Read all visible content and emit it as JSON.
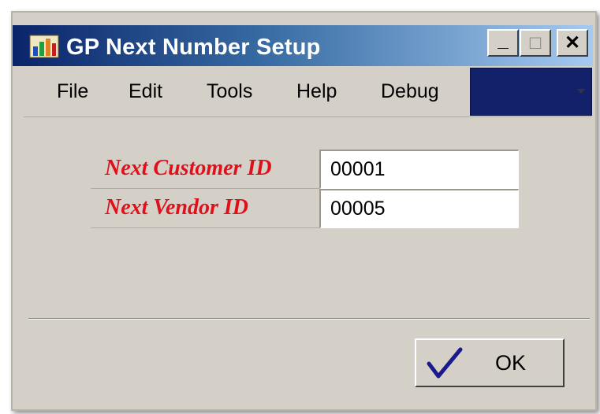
{
  "window": {
    "title": "GP Next Number Setup",
    "controls": {
      "minimize": "_",
      "maximize": "□",
      "close": "✕"
    }
  },
  "menu": {
    "items": [
      "File",
      "Edit",
      "Tools",
      "Help",
      "Debug"
    ]
  },
  "toolbar": {
    "dropdown_color": "#13216a"
  },
  "form": {
    "fields": [
      {
        "label": "Next Customer ID",
        "value": "00001"
      },
      {
        "label": "Next Vendor ID",
        "value": "00005"
      }
    ],
    "label_color": "#e0101a"
  },
  "buttons": {
    "ok_label": "OK"
  },
  "icons": {
    "app": "app-icon",
    "ok": "checkmark-icon"
  }
}
